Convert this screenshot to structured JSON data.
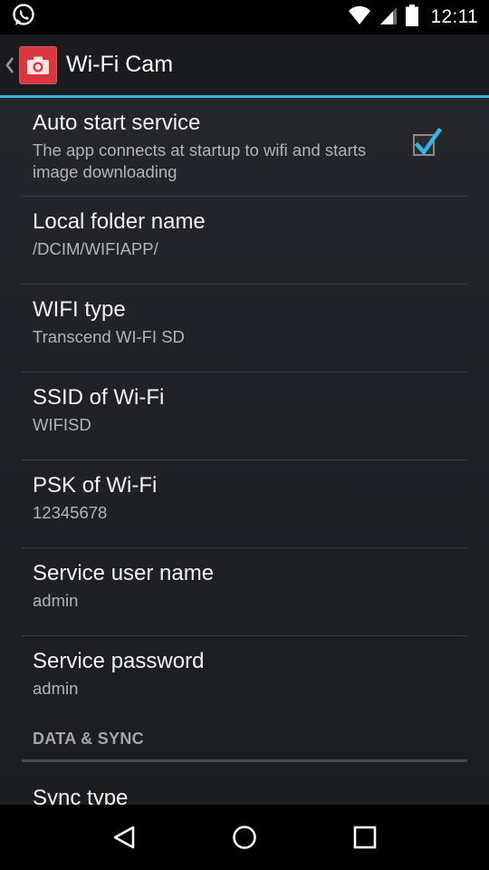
{
  "status_bar": {
    "time": "12:11",
    "icons": [
      "whatsapp-icon",
      "wifi-icon",
      "signal-icon",
      "battery-icon"
    ]
  },
  "action_bar": {
    "title": "Wi-Fi Cam",
    "accent_color": "#33b5e5",
    "icon_color": "#d9363e"
  },
  "preferences": [
    {
      "title": "Auto start service",
      "summary": "The app connects at startup to wifi and starts image downloading",
      "checked": true
    },
    {
      "title": "Local folder name",
      "summary": "/DCIM/WIFIAPP/"
    },
    {
      "title": "WIFI type",
      "summary": "Transcend WI-FI SD"
    },
    {
      "title": "SSID of Wi-Fi",
      "summary": "WIFISD"
    },
    {
      "title": "PSK of Wi-Fi",
      "summary": "12345678"
    },
    {
      "title": "Service user name",
      "summary": "admin"
    },
    {
      "title": "Service password",
      "summary": "admin"
    }
  ],
  "category": {
    "label": "DATA & SYNC"
  },
  "partial_item": {
    "title": "Sync type"
  },
  "nav_bar": {
    "buttons": [
      "back-icon",
      "home-icon",
      "recents-icon"
    ]
  }
}
